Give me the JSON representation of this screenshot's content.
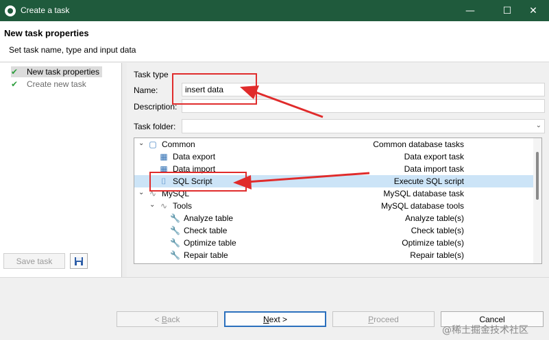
{
  "window": {
    "title": "Create a task",
    "controls": [
      "minimize-icon",
      "maximize-icon",
      "close-icon"
    ]
  },
  "header": {
    "title": "New task properties",
    "subtitle": "Set task name, type and input data"
  },
  "steps": [
    {
      "label": "New task properties",
      "selected": true
    },
    {
      "label": "Create new task",
      "selected": false
    }
  ],
  "left_buttons": {
    "save_task": "Save task"
  },
  "form": {
    "legend": "Task type",
    "name_label": "Name:",
    "name_value": "insert data",
    "description_label": "Description:",
    "description_value": "",
    "folder_label": "Task folder:",
    "folder_value": ""
  },
  "tree": [
    {
      "name": "Common",
      "desc": "Common database tasks",
      "icon": "folder-icon",
      "expanded": true
    },
    {
      "name": "Data export",
      "desc": "Data export task",
      "icon": "table-export-icon"
    },
    {
      "name": "Data import",
      "desc": "Data import task",
      "icon": "table-import-icon"
    },
    {
      "name": "SQL Script",
      "desc": "Execute SQL script",
      "icon": "script-icon",
      "selected": true
    },
    {
      "name": "MySQL",
      "desc": "MySQL database task",
      "icon": "mysql-icon",
      "expanded": true
    },
    {
      "name": "Tools",
      "desc": "MySQL database tools",
      "icon": "mysql-icon",
      "expanded": true
    },
    {
      "name": "Analyze table",
      "desc": "Analyze table(s)",
      "icon": "wrench-icon"
    },
    {
      "name": "Check table",
      "desc": "Check table(s)",
      "icon": "wrench-icon"
    },
    {
      "name": "Optimize table",
      "desc": "Optimize table(s)",
      "icon": "wrench-icon"
    },
    {
      "name": "Repair table",
      "desc": "Repair table(s)",
      "icon": "wrench-icon"
    }
  ],
  "footer_buttons": {
    "back": {
      "prefix": "< ",
      "key": "B",
      "rest": "ack"
    },
    "next": {
      "key": "N",
      "rest": "ext >"
    },
    "proceed": {
      "key": "P",
      "rest": "roceed"
    },
    "cancel": "Cancel"
  },
  "watermark": "@稀土掘金技术社区",
  "colors": {
    "titlebar": "#1f5a3c",
    "annotation": "#e02b2b",
    "selection": "#cce4f7",
    "check": "#2e9e3e"
  }
}
